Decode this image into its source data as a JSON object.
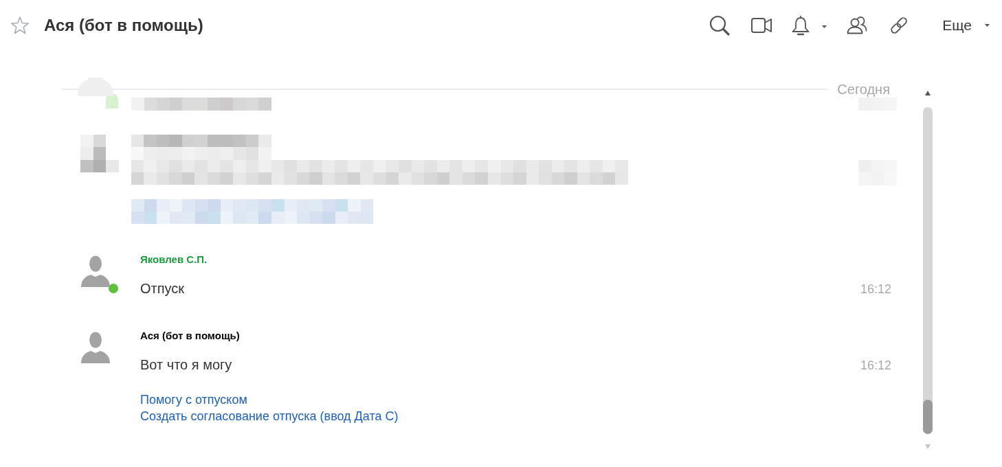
{
  "header": {
    "title": "Ася (бот в помощь)",
    "starred": false,
    "more_menu": {
      "label": "Еще"
    }
  },
  "date_separator": "Сегодня",
  "messages": [
    {
      "author": "Яковлев С.П.",
      "color": "#1a9c3c",
      "online": true,
      "text": "Отпуск",
      "time": "16:12"
    },
    {
      "author": "Ася (бот в помощь)",
      "color": "#000000",
      "online": false,
      "text": "Вот что я могу",
      "time": "16:12",
      "links": [
        "Помогу с отпуском",
        "Создать согласование отпуска (ввод Дата С)"
      ]
    }
  ]
}
